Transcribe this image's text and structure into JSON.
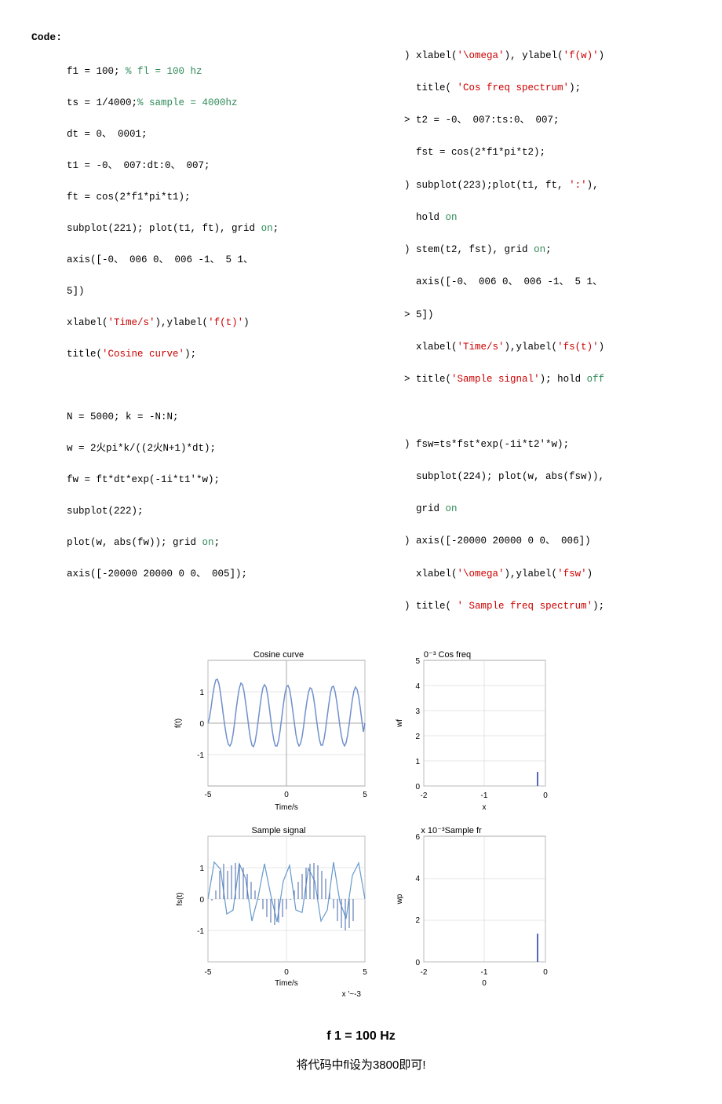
{
  "code_label": "Code:",
  "left_code_lines": [
    {
      "text": "f1 = 100; ",
      "type": "normal"
    },
    {
      "text": "% fl = 100 hz",
      "type": "comment"
    },
    {
      "text": "ts = 1/4000;",
      "type": "normal"
    },
    {
      "text": "% sample = 4000hz",
      "type": "comment"
    },
    {
      "text": "dt = 0、 0001;",
      "type": "normal"
    },
    {
      "text": "t1 = -0、 007:dt:0、 007;",
      "type": "normal"
    },
    {
      "text": "ft = cos(2*f1*pi*t1);",
      "type": "normal"
    },
    {
      "text": "subplot(221); plot(t1, ft), grid ",
      "type": "normal"
    },
    {
      "text": "on",
      "type": "on"
    },
    {
      "text": ";",
      "type": "normal"
    },
    {
      "text": "axis([-0、 006 0、 006 -1、 5 1、",
      "type": "normal"
    },
    {
      "text": "5])",
      "type": "normal"
    },
    {
      "text": "xlabel(",
      "type": "normal"
    },
    {
      "text": "'Time/s'",
      "type": "string"
    },
    {
      "text": "),ylabel(",
      "type": "normal"
    },
    {
      "text": "'f(t)'",
      "type": "string"
    },
    {
      "text": ")",
      "type": "normal"
    },
    {
      "text": "title('Cosine curve');",
      "type": "normal"
    },
    {
      "text": "",
      "type": "blank"
    },
    {
      "text": "N = 5000; k = -N:N;",
      "type": "normal"
    },
    {
      "text": "w = 2火pi*k/((2火N+1)*dt);",
      "type": "normal"
    },
    {
      "text": "fw = ft*dt*exp(-1i*t1'*w);",
      "type": "normal"
    },
    {
      "text": "subplot(222);",
      "type": "normal"
    },
    {
      "text": "plot(w, abs(fw)); grid ",
      "type": "normal"
    },
    {
      "text": "on",
      "type": "on"
    },
    {
      "text": ";",
      "type": "normal"
    },
    {
      "text": "axis([-20000 20000 0 0、 005]);",
      "type": "normal"
    }
  ],
  "right_code": {
    "lines": [
      "> xlabel('\\omega'), ylabel('f(w)')",
      "  title( 'Cos freq spectrum');",
      "> t2 = -0、 007:ts:0、 007;",
      "  fst = cos(2*f1*pi*t2);",
      ") subplot(223);plot(t1, ft, ':'),",
      "  hold on",
      ") stem(t2, fst), grid on;",
      "  axis([-0、 006 0、 006 -1、 5 1、",
      "> 5])",
      "  xlabel('Time/s'),ylabel('fs(t)')",
      "> title('Sample signal'); hold off",
      "",
      ") fsw=ts*fst*exp(-1i*t2'*w);",
      "  subplot(224); plot(w, abs(fsw)),",
      "  grid on",
      ") axis([-20000 20000 0 0、 006])",
      "  xlabel('\\omega'),ylabel('fsw')",
      ") title( ' Sample freq spectrum');"
    ]
  },
  "plots": {
    "top_left": {
      "title": "Cosine curve",
      "xlabel": "Time/s",
      "ylabel": "f(t)",
      "x_range": [
        -5,
        5
      ],
      "y_range": [
        -1.5,
        1.5
      ],
      "x_ticks": [
        -5,
        0,
        5
      ],
      "y_ticks": [
        -1,
        0,
        1
      ]
    },
    "top_right": {
      "title": "0⁻³ Cos freq",
      "xlabel": "x",
      "ylabel": "wf",
      "x_range": [
        -2,
        0
      ],
      "y_range": [
        0,
        5
      ],
      "x_ticks": [
        -2,
        -1,
        0
      ],
      "y_ticks": [
        0,
        1,
        2,
        3,
        4,
        5
      ]
    },
    "bottom_left": {
      "title": "Sample signal",
      "xlabel": "Time/s",
      "xlabel2": "x '~-3",
      "ylabel": "fs(t)",
      "x_range": [
        -5,
        5
      ],
      "y_range": [
        -1.5,
        1.5
      ],
      "x_ticks": [
        -5,
        0,
        5
      ],
      "y_ticks": [
        -1,
        0,
        1
      ]
    },
    "bottom_right": {
      "title": "x 10⁻³Sample fr",
      "xlabel": "0",
      "ylabel": "wp",
      "x_range": [
        -2,
        0
      ],
      "y_range": [
        0,
        6
      ],
      "x_ticks": [
        -2,
        -1,
        0
      ],
      "y_ticks": [
        0,
        2,
        4,
        6
      ]
    }
  },
  "bottom": {
    "formula": "f 1 = 100  Hz",
    "chinese": "将代码中fl设为3800即可!"
  }
}
